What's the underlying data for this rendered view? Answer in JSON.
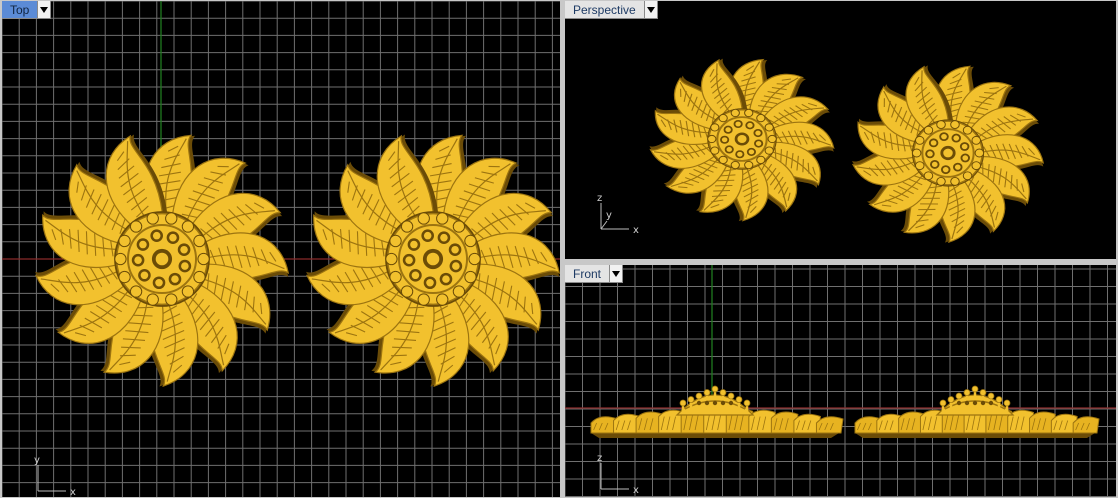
{
  "viewports": {
    "top": {
      "label": "Top"
    },
    "perspective": {
      "label": "Perspective"
    },
    "front": {
      "label": "Front"
    }
  },
  "axes": {
    "top": [
      "y",
      "x"
    ],
    "perspective": [
      "z",
      "y",
      "x"
    ],
    "front": [
      "z",
      "x"
    ]
  },
  "colors": {
    "background": "#000000",
    "grid": "#6f6f6f",
    "grid_major": "#9a9a9a",
    "x_axis": "#8a2a2a",
    "y_axis": "#1f7a1f",
    "model": "#f2c12e",
    "model_shade": "#9c7410",
    "model_dark": "#6b4c07",
    "active_tab": "#5b8bd6"
  },
  "icons": {
    "viewport_menu": "triangle-down-icon"
  }
}
